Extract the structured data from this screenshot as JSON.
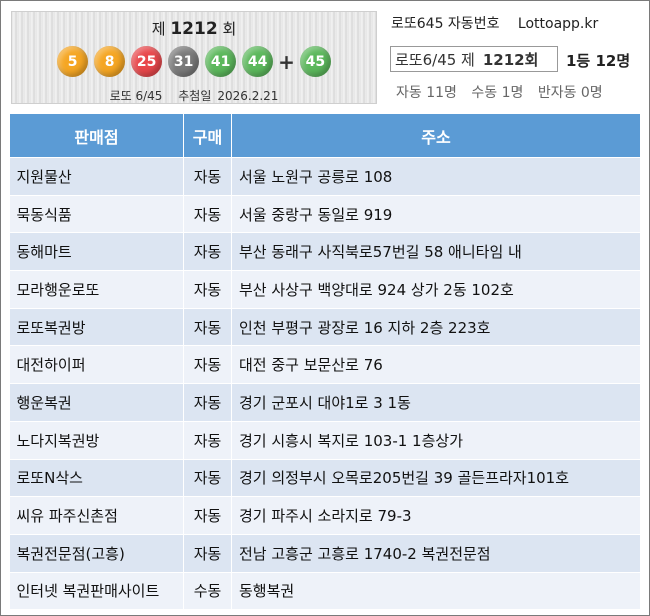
{
  "draw": {
    "prefix": "제",
    "number": "1212",
    "suffix": "회",
    "balls": [
      {
        "n": "5",
        "color": "#f5a623"
      },
      {
        "n": "8",
        "color": "#f5a623"
      },
      {
        "n": "25",
        "color": "#e8474b"
      },
      {
        "n": "31",
        "color": "#7a7a7a"
      },
      {
        "n": "41",
        "color": "#5cb85c"
      },
      {
        "n": "44",
        "color": "#5cb85c"
      }
    ],
    "plus": "+",
    "bonus": {
      "n": "45",
      "color": "#5cb85c"
    },
    "game": "로또 6/45",
    "date_label": "추첨일",
    "date": "2026.2.21"
  },
  "header": {
    "title": "로또645 자동번호",
    "site": "Lottoapp.kr",
    "round_label": "로또6/45 제",
    "round_number": "1212회",
    "first_prize": "1등 12명",
    "auto": "자동 11명",
    "manual": "수동 1명",
    "semi": "반자동 0명"
  },
  "table": {
    "headers": [
      "판매점",
      "구매",
      "주소"
    ],
    "rows": [
      [
        "지원물산",
        "자동",
        "서울 노원구 공릉로 108"
      ],
      [
        "묵동식품",
        "자동",
        "서울 중랑구 동일로 919"
      ],
      [
        "동해마트",
        "자동",
        "부산 동래구 사직북로57번길 58 애니타임 내"
      ],
      [
        "모라행운로또",
        "자동",
        "부산 사상구 백양대로 924 상가 2동 102호"
      ],
      [
        "로또복권방",
        "자동",
        "인천 부평구 광장로 16 지하 2층 223호"
      ],
      [
        "대전하이퍼",
        "자동",
        "대전 중구 보문산로 76"
      ],
      [
        "행운복권",
        "자동",
        "경기 군포시 대야1로 3 1동"
      ],
      [
        "노다지복권방",
        "자동",
        "경기 시흥시 복지로 103-1 1층상가"
      ],
      [
        "로또N삭스",
        "자동",
        "경기 의정부시 오목로205번길 39 골든프라자101호"
      ],
      [
        "씨유 파주신촌점",
        "자동",
        "경기 파주시 소라지로 79-3"
      ],
      [
        "복권전문점(고흥)",
        "자동",
        "전남 고흥군 고흥로 1740-2 복권전문점"
      ],
      [
        "인터넷 복권판매사이트",
        "수동",
        "동행복권"
      ]
    ]
  }
}
